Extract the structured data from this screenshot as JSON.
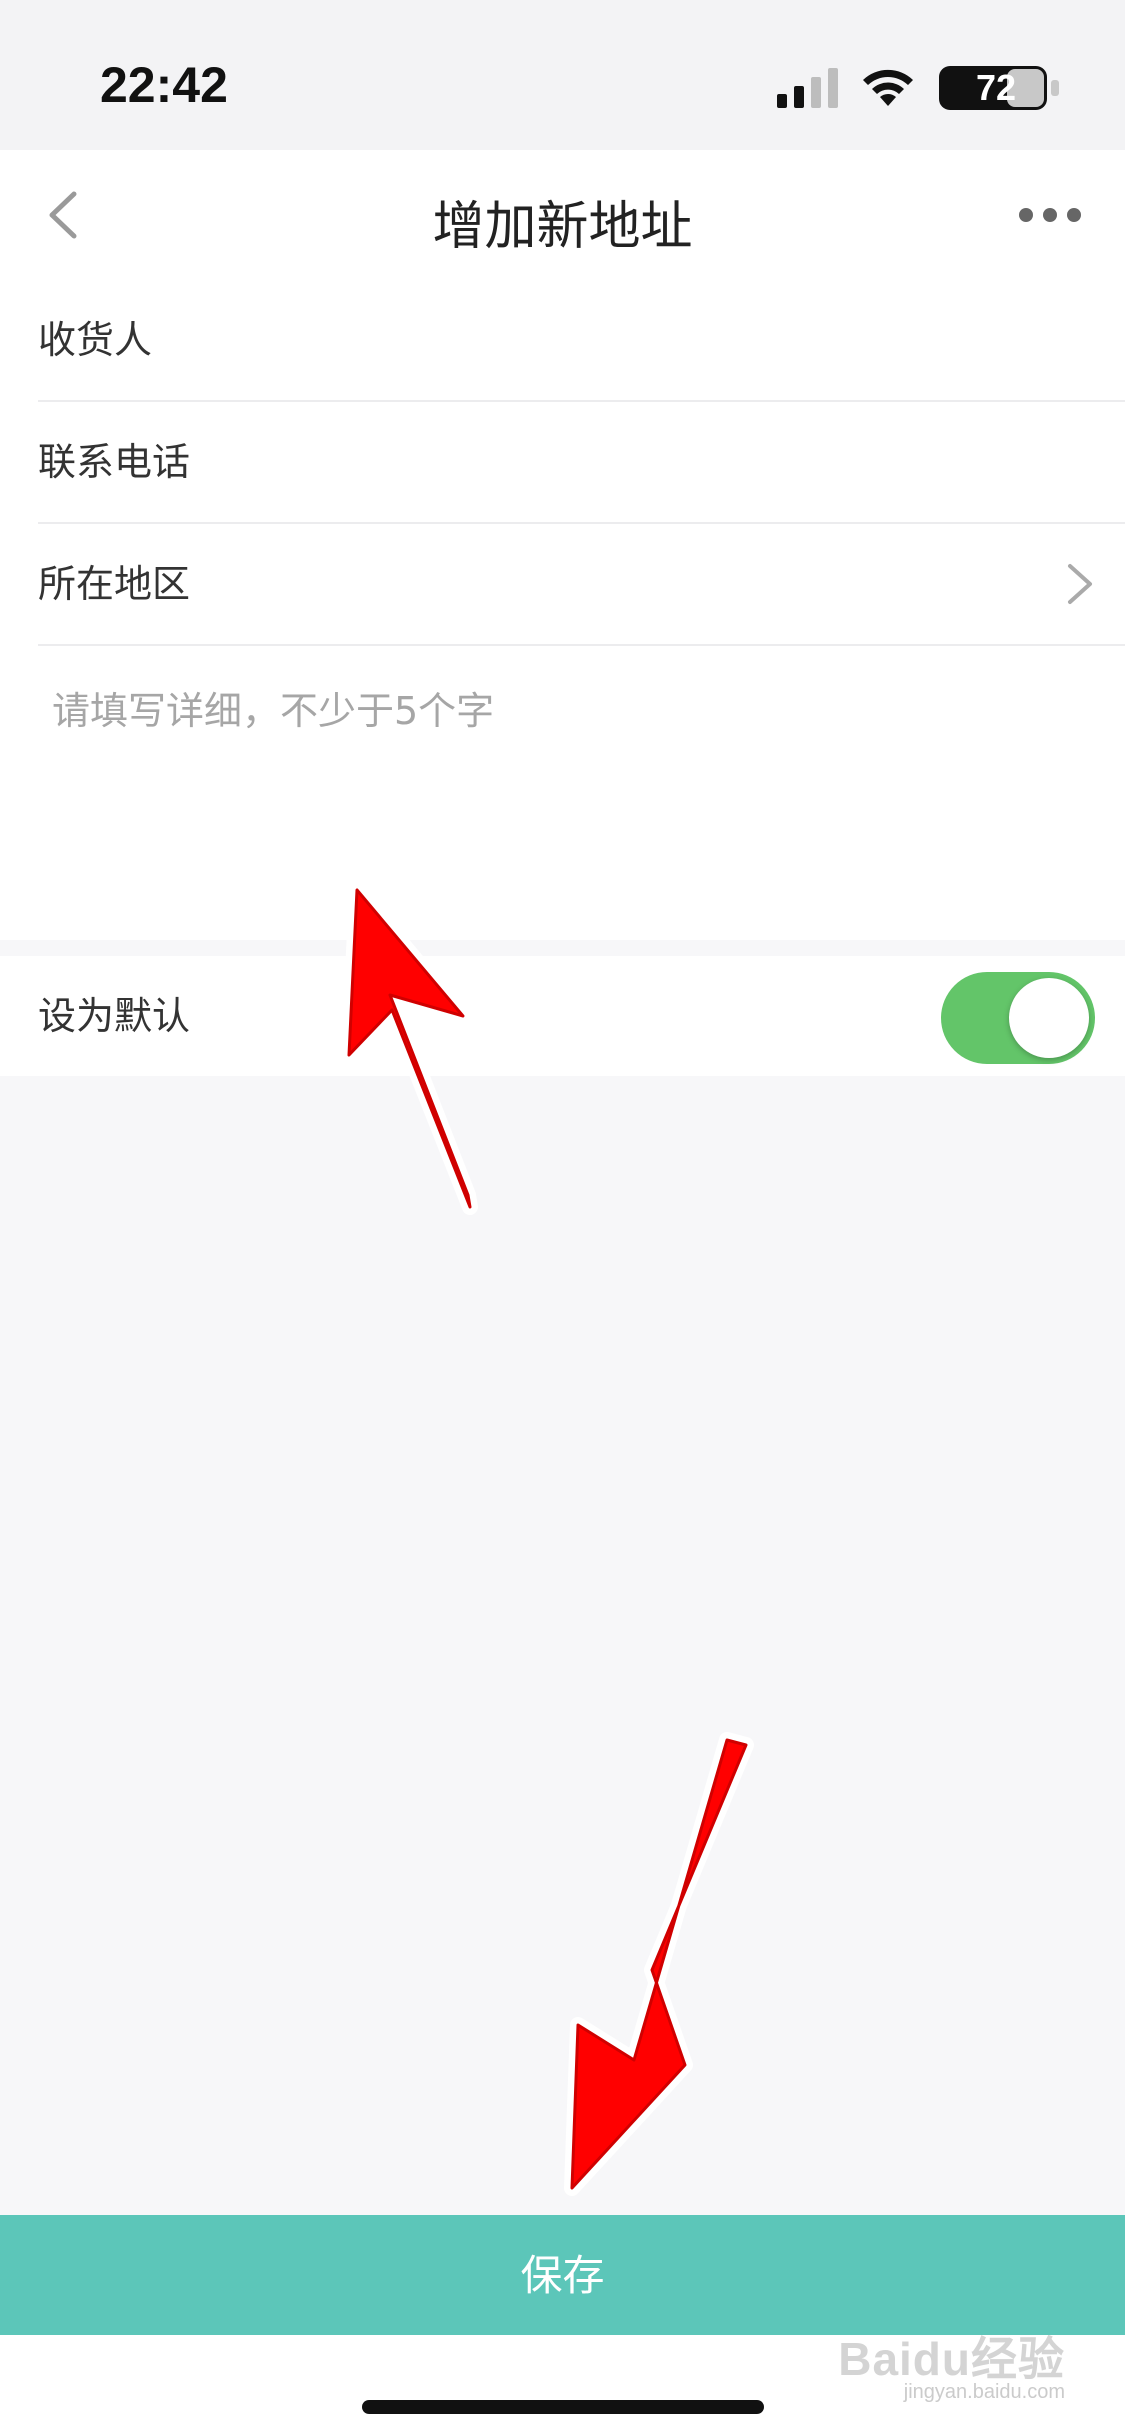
{
  "status_bar": {
    "time": "22:42",
    "battery_level": "72"
  },
  "header": {
    "title": "增加新地址"
  },
  "form": {
    "fields": [
      {
        "label": "收货人"
      },
      {
        "label": "联系电话"
      },
      {
        "label": "所在地区"
      }
    ],
    "detail_placeholder": "请填写详细，不少于5个字",
    "default_label": "设为默认",
    "default_on": true
  },
  "footer": {
    "save_label": "保存"
  },
  "watermark": {
    "logo": "Baidu经验",
    "url": "jingyan.baidu.com"
  },
  "colors": {
    "accent_teal": "#5cc6b9",
    "toggle_green": "#63c569",
    "annotation_red": "#ff0000"
  }
}
